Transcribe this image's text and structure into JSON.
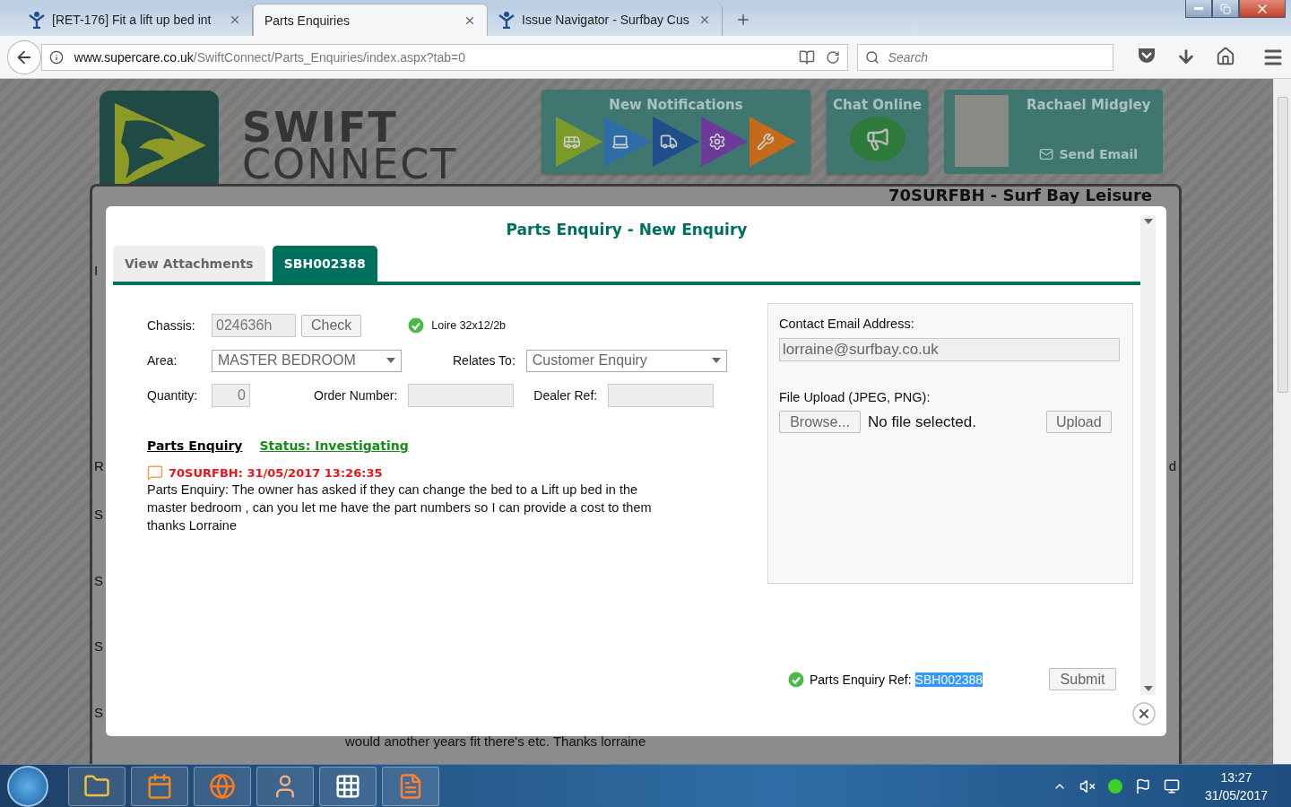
{
  "browser": {
    "tabs": [
      {
        "title": "[RET-176] Fit a lift up bed int",
        "selected": false,
        "kind": "figure"
      },
      {
        "title": "Parts Enquiries",
        "selected": true,
        "kind": "none"
      },
      {
        "title": "Issue Navigator - Surfbay Cus",
        "selected": false,
        "kind": "figure"
      }
    ],
    "url_host": "www.supercare.co.uk",
    "url_path": "/SwiftConnect/Parts_Enquiries/index.aspx?tab=0",
    "search_placeholder": "Search"
  },
  "header": {
    "logo_line1": "SWIFT",
    "logo_line2": "CONNECT",
    "notifications_title": "New Notifications",
    "chat_title": "Chat Online",
    "profile_name": "Rachael Midgley",
    "send_email": "Send Email",
    "dealer_title": "70SURFBH - Surf Bay Leisure"
  },
  "background": {
    "rows": [
      {
        "start": "I"
      },
      {
        "start": "R",
        "end": "d"
      },
      {
        "start": "S"
      },
      {
        "start": "S"
      },
      {
        "start": "S"
      },
      {
        "start": "S",
        "note": "would another years fit there's etc. Thanks lorraine"
      }
    ]
  },
  "modal": {
    "title": "Parts Enquiry - New Enquiry",
    "tabs": [
      {
        "label": "View Attachments",
        "selected": false
      },
      {
        "label": "SBH002388",
        "selected": true
      }
    ],
    "chassis": {
      "label": "Chassis:",
      "value": "024636h",
      "button": "Check",
      "result": "Loire 32x12/2b"
    },
    "area": {
      "label": "Area:",
      "value": "MASTER BEDROOM"
    },
    "relates_to": {
      "label": "Relates To:",
      "value": "Customer Enquiry"
    },
    "quantity": {
      "label": "Quantity:",
      "value": "0"
    },
    "order_number": {
      "label": "Order Number:"
    },
    "dealer_ref": {
      "label": "Dealer Ref:"
    },
    "enquiry_link": "Parts Enquiry",
    "status_link": "Status: Investigating",
    "comment": {
      "author_time": "70SURFBH: 31/05/2017 13:26:35",
      "text": "Parts Enquiry: The owner has asked if they can change the bed to a Lift up bed in the master bedroom , can you let me have the part numbers so I can provide a cost to them thanks Lorraine"
    },
    "contact_email": {
      "label": "Contact Email Address:",
      "value": "lorraine@surfbay.co.uk"
    },
    "file_upload": {
      "label": "File Upload (JPEG, PNG):",
      "browse": "Browse...",
      "status": "No file selected.",
      "upload": "Upload"
    },
    "reference": {
      "label": "Parts Enquiry Ref:",
      "value": "SBH002388"
    },
    "submit": "Submit"
  },
  "taskbar": {
    "time": "13:27",
    "date": "31/05/2017"
  }
}
